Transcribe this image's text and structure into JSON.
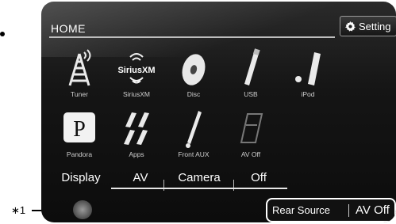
{
  "header": {
    "title": "HOME",
    "setting_label": "Setting"
  },
  "tiles": [
    {
      "label": "Tuner",
      "icon": "tower-icon"
    },
    {
      "label": "SiriusXM",
      "icon": "siriusxm-icon"
    },
    {
      "label": "Disc",
      "icon": "disc-icon"
    },
    {
      "label": "USB",
      "icon": "usb-icon"
    },
    {
      "label": "iPod",
      "icon": "ipod-icon"
    },
    {
      "label": "Pandora",
      "icon": "pandora-icon"
    },
    {
      "label": "Apps",
      "icon": "apps-icon"
    },
    {
      "label": "Front AUX",
      "icon": "aux-icon"
    },
    {
      "label": "AV Off",
      "icon": "avoff-icon"
    }
  ],
  "logo_text": "SiriusXM",
  "tabs": {
    "display": "Display",
    "av": "AV",
    "camera": "Camera",
    "off": "Off"
  },
  "bottom": {
    "rear_source": "Rear Source",
    "av_off": "AV Off"
  },
  "callout": "∗1"
}
